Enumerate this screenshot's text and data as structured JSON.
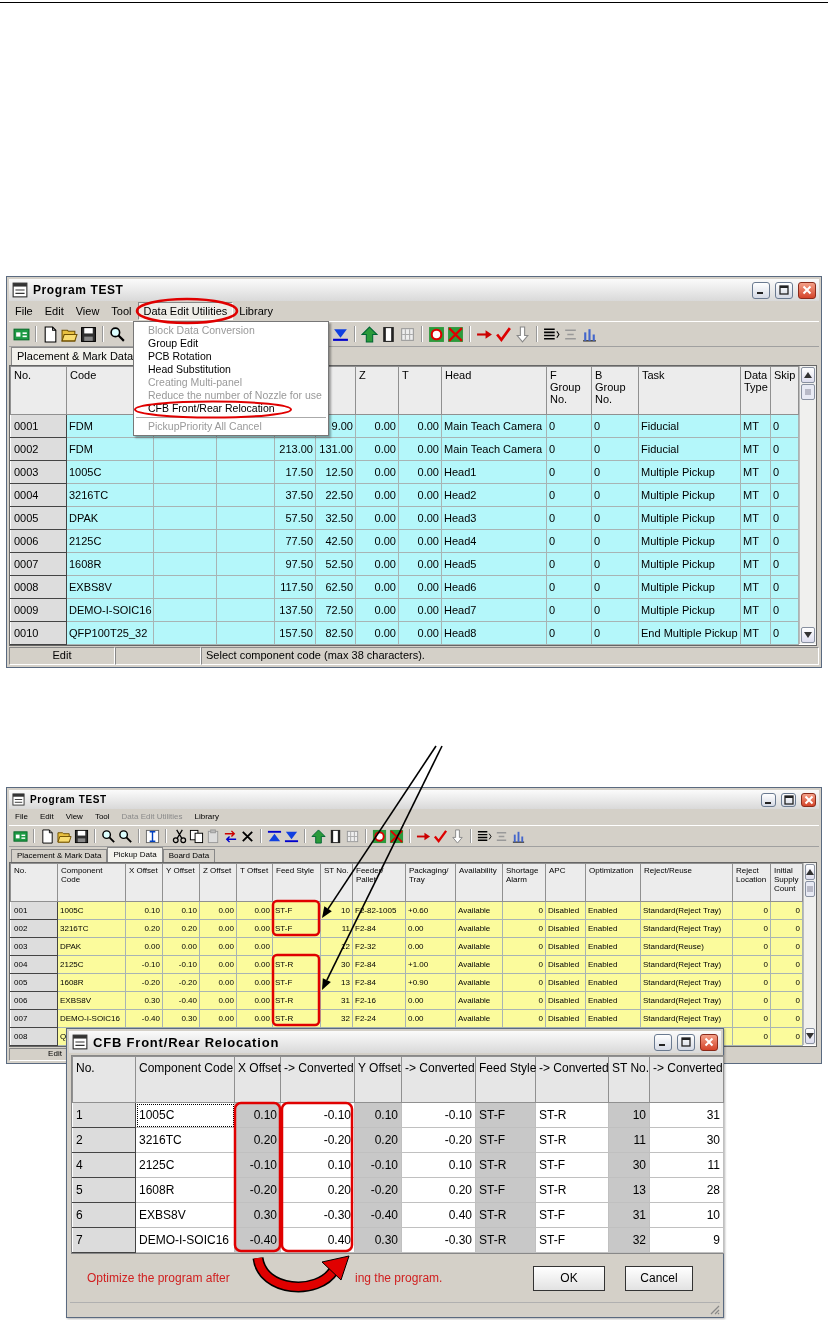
{
  "windows": [
    {
      "title": "Program TEST",
      "menu": [
        {
          "label": "File",
          "open": false,
          "disabled": false
        },
        {
          "label": "Edit",
          "open": false,
          "disabled": false
        },
        {
          "label": "View",
          "open": false,
          "disabled": false
        },
        {
          "label": "Tool",
          "open": false,
          "disabled": false
        },
        {
          "label": "Data Edit Utilities",
          "open": true,
          "disabled": false
        },
        {
          "label": "Library",
          "open": false,
          "disabled": false
        }
      ],
      "menu_popup": {
        "items": [
          {
            "kind": "item",
            "label": "Block Data Conversion",
            "disabled": true
          },
          {
            "kind": "item",
            "label": "Group Edit",
            "disabled": false
          },
          {
            "kind": "item",
            "label": "PCB Rotation",
            "disabled": false
          },
          {
            "kind": "item",
            "label": "Head Substitution",
            "disabled": false
          },
          {
            "kind": "item",
            "label": "Creating Multi-panel",
            "disabled": true
          },
          {
            "kind": "item",
            "label": "Reduce the number of Nozzle for use",
            "disabled": true
          },
          {
            "kind": "item",
            "label": "CFB Front/Rear Relocation",
            "disabled": false
          },
          {
            "kind": "separator"
          },
          {
            "kind": "item",
            "label": "PickupPriority All Cancel",
            "disabled": true
          }
        ]
      },
      "tabs": [
        {
          "label": "Placement & Mark Data",
          "selected": true
        }
      ],
      "table": {
        "columns": [
          "No.",
          "Code",
          null,
          null,
          null,
          null,
          "Z",
          "T",
          "Head",
          "F Group No.",
          "B Group No.",
          "Task",
          "Data Type",
          "Skip"
        ],
        "rows": [
          [
            "0001",
            "FDM",
            null,
            null,
            null,
            "9.00",
            "0.00",
            "0.00",
            "Main Teach Camera",
            "0",
            "0",
            "Fiducial",
            "MT",
            "0"
          ],
          [
            "0002",
            "FDM",
            null,
            null,
            "213.00",
            "131.00",
            "0.00",
            "0.00",
            "Main Teach Camera",
            "0",
            "0",
            "Fiducial",
            "MT",
            "0"
          ],
          [
            "0003",
            "1005C",
            null,
            null,
            "17.50",
            "12.50",
            "0.00",
            "0.00",
            "Head1",
            "0",
            "0",
            "Multiple Pickup",
            "MT",
            "0"
          ],
          [
            "0004",
            "3216TC",
            null,
            null,
            "37.50",
            "22.50",
            "0.00",
            "0.00",
            "Head2",
            "0",
            "0",
            "Multiple Pickup",
            "MT",
            "0"
          ],
          [
            "0005",
            "DPAK",
            null,
            null,
            "57.50",
            "32.50",
            "0.00",
            "0.00",
            "Head3",
            "0",
            "0",
            "Multiple Pickup",
            "MT",
            "0"
          ],
          [
            "0006",
            "2125C",
            null,
            null,
            "77.50",
            "42.50",
            "0.00",
            "0.00",
            "Head4",
            "0",
            "0",
            "Multiple Pickup",
            "MT",
            "0"
          ],
          [
            "0007",
            "1608R",
            null,
            null,
            "97.50",
            "52.50",
            "0.00",
            "0.00",
            "Head5",
            "0",
            "0",
            "Multiple Pickup",
            "MT",
            "0"
          ],
          [
            "0008",
            "EXBS8V",
            null,
            null,
            "117.50",
            "62.50",
            "0.00",
            "0.00",
            "Head6",
            "0",
            "0",
            "Multiple Pickup",
            "MT",
            "0"
          ],
          [
            "0009",
            "DEMO-I-SOIC16",
            null,
            null,
            "137.50",
            "72.50",
            "0.00",
            "0.00",
            "Head7",
            "0",
            "0",
            "Multiple Pickup",
            "MT",
            "0"
          ],
          [
            "0010",
            "QFP100T25_32",
            null,
            null,
            "157.50",
            "82.50",
            "0.00",
            "0.00",
            "Head8",
            "0",
            "0",
            "End Multiple Pickup",
            "MT",
            "0"
          ]
        ]
      },
      "status_bar": [
        "Edit",
        "Select component code (max 38 characters)."
      ]
    },
    {
      "title": "Program TEST",
      "menu": [
        {
          "label": "File",
          "open": false,
          "disabled": false
        },
        {
          "label": "Edit",
          "open": false,
          "disabled": false
        },
        {
          "label": "View",
          "open": false,
          "disabled": false
        },
        {
          "label": "Tool",
          "open": false,
          "disabled": false
        },
        {
          "label": "Data Edit Utilities",
          "open": false,
          "disabled": true
        },
        {
          "label": "Library",
          "open": false,
          "disabled": false
        }
      ],
      "tabs": [
        {
          "label": "Placement & Mark Data",
          "selected": false
        },
        {
          "label": "Pickup Data",
          "selected": true
        },
        {
          "label": "Board Data",
          "selected": false
        }
      ],
      "table": {
        "columns": [
          "No.",
          "Component Code",
          "X Offset",
          "Y Offset",
          "Z Offset",
          "T Offset",
          "Feed Style",
          "ST No.",
          "Feeder/ Pallet",
          "Packaging/ Tray",
          "Availability",
          "Shortage Alarm",
          "APC",
          "Optimization",
          "Reject/Reuse",
          "Reject Location",
          "Initial Supply Count"
        ],
        "rows": [
          [
            "001",
            "1005C",
            "0.10",
            "0.10",
            "0.00",
            "0.00",
            "ST-F",
            "10",
            "F2-82-1005",
            "+0.60",
            "Available",
            "0",
            "Disabled",
            "Enabled",
            "Standard(Reject Tray)",
            "0",
            "0"
          ],
          [
            "002",
            "3216TC",
            "0.20",
            "0.20",
            "0.00",
            "0.00",
            "ST-F",
            "11",
            "F2-84",
            "0.00",
            "Available",
            "0",
            "Disabled",
            "Enabled",
            "Standard(Reject Tray)",
            "0",
            "0"
          ],
          [
            "003",
            "DPAK",
            "0.00",
            "0.00",
            "0.00",
            "0.00",
            null,
            "12",
            "F2-32",
            "0.00",
            "Available",
            "0",
            "Disabled",
            "Enabled",
            "Standard(Reuse)",
            "0",
            "0"
          ],
          [
            "004",
            "2125C",
            "-0.10",
            "-0.10",
            "0.00",
            "0.00",
            "ST-R",
            "30",
            "F2-84",
            "+1.00",
            "Available",
            "0",
            "Disabled",
            "Enabled",
            "Standard(Reject Tray)",
            "0",
            "0"
          ],
          [
            "005",
            "1608R",
            "-0.20",
            "-0.20",
            "0.00",
            "0.00",
            "ST-F",
            "13",
            "F2-84",
            "+0.90",
            "Available",
            "0",
            "Disabled",
            "Enabled",
            "Standard(Reject Tray)",
            "0",
            "0"
          ],
          [
            "006",
            "EXBS8V",
            "0.30",
            "-0.40",
            "0.00",
            "0.00",
            "ST-R",
            "31",
            "F2-16",
            "0.00",
            "Available",
            "0",
            "Disabled",
            "Enabled",
            "Standard(Reject Tray)",
            "0",
            "0"
          ],
          [
            "007",
            "DEMO-I-SOIC16",
            "-0.40",
            "0.30",
            "0.00",
            "0.00",
            "ST-R",
            "32",
            "F2-24",
            "0.00",
            "Available",
            "0",
            "Disabled",
            "Enabled",
            "Standard(Reject Tray)",
            "0",
            "0"
          ],
          [
            "008",
            "Q",
            null,
            null,
            null,
            null,
            null,
            null,
            null,
            null,
            null,
            null,
            null,
            null,
            null,
            "0",
            "0"
          ]
        ]
      },
      "status_bar": [
        "Edit"
      ]
    }
  ],
  "dialog": {
    "title": "CFB Front/Rear Relocation",
    "table": {
      "columns": [
        "No.",
        "Component Code",
        "X Offset",
        "-> Converted",
        "Y Offset",
        "-> Converted",
        "Feed Style",
        "-> Converted",
        "ST No.",
        "-> Converted"
      ],
      "rows": [
        {
          "focused": true,
          "cells": [
            "1",
            "1005C",
            "0.10",
            "-0.10",
            "0.10",
            "-0.10",
            "ST-F",
            "ST-R",
            "10",
            "31"
          ]
        },
        {
          "focused": false,
          "cells": [
            "2",
            "3216TC",
            "0.20",
            "-0.20",
            "0.20",
            "-0.20",
            "ST-F",
            "ST-R",
            "11",
            "30"
          ]
        },
        {
          "focused": false,
          "cells": [
            "4",
            "2125C",
            "-0.10",
            "0.10",
            "-0.10",
            "0.10",
            "ST-R",
            "ST-F",
            "30",
            "11"
          ]
        },
        {
          "focused": false,
          "cells": [
            "5",
            "1608R",
            "-0.20",
            "0.20",
            "-0.20",
            "0.20",
            "ST-F",
            "ST-R",
            "13",
            "28"
          ]
        },
        {
          "focused": false,
          "cells": [
            "6",
            "EXBS8V",
            "0.30",
            "-0.30",
            "-0.40",
            "0.40",
            "ST-R",
            "ST-F",
            "31",
            "10"
          ]
        },
        {
          "focused": false,
          "cells": [
            "7",
            "DEMO-I-SOIC16",
            "-0.40",
            "0.40",
            "0.30",
            "-0.30",
            "ST-R",
            "ST-F",
            "32",
            "9"
          ]
        }
      ]
    },
    "message_parts": [
      "Optimize the program after",
      "ing the program."
    ],
    "buttons": [
      "OK",
      "Cancel"
    ]
  }
}
